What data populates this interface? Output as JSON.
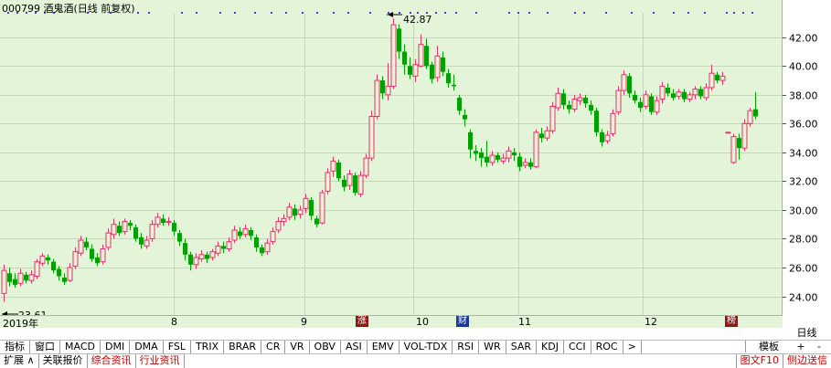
{
  "stock": {
    "code": "000799",
    "name": "酒鬼酒",
    "period": "(日线 前复权)"
  },
  "colors": {
    "up": "#e8306a",
    "down": "#00a000",
    "grid": "#c3d8b4",
    "background": "#e4f4d8"
  },
  "marks": {
    "high": "42.87",
    "low": "23.61"
  },
  "badges": {
    "rise": "涨",
    "fin": "财",
    "list": "榜"
  },
  "x_axis": {
    "year_label": "2019年",
    "months": [
      "8",
      "9",
      "10",
      "11",
      "12"
    ]
  },
  "right_panel": {
    "period_label": "日线",
    "template_label": "模板",
    "plus_label": "+",
    "minus_label": "-"
  },
  "tabs": [
    "指标",
    "窗口",
    "MACD",
    "DMI",
    "DMA",
    "FSL",
    "TRIX",
    "BRAR",
    "CR",
    "VR",
    "OBV",
    "ASI",
    "EMV",
    "VOL-TDX",
    "RSI",
    "WR",
    "SAR",
    "KDJ",
    "CCI",
    "ROC",
    ">"
  ],
  "status": {
    "expand": "扩展",
    "items": [
      "关联报价",
      "综合资讯",
      "行业资讯"
    ],
    "f10": "图文F10",
    "side": "侧边送信"
  },
  "chart_data": {
    "type": "candlestick",
    "y_axis_ticks": [
      24,
      26,
      28,
      30,
      32,
      34,
      36,
      38,
      40,
      42
    ],
    "y_tick_labels": [
      "24.00",
      "26.00",
      "28.00",
      "30.00",
      "32.00",
      "34.00",
      "36.00",
      "38.00",
      "40.00",
      "42.00"
    ],
    "ylim": [
      22.7,
      43.7
    ],
    "grid": true,
    "candles": [
      [
        24.2,
        25.8,
        26.2,
        23.61
      ],
      [
        25.6,
        25.0,
        26.0,
        24.7
      ],
      [
        25.2,
        24.8,
        25.6,
        24.6
      ],
      [
        24.9,
        25.6,
        25.9,
        24.7
      ],
      [
        25.5,
        25.1,
        25.7,
        24.9
      ],
      [
        25.1,
        25.5,
        25.8,
        24.9
      ],
      [
        25.4,
        26.4,
        26.6,
        25.2
      ],
      [
        26.3,
        26.8,
        27.0,
        26.1
      ],
      [
        26.7,
        26.5,
        26.9,
        26.2
      ],
      [
        26.4,
        25.8,
        26.6,
        25.6
      ],
      [
        25.9,
        25.4,
        26.1,
        25.1
      ],
      [
        25.3,
        25.0,
        25.6,
        24.8
      ],
      [
        25.1,
        26.0,
        26.3,
        25.0
      ],
      [
        26.1,
        27.1,
        27.4,
        25.9
      ],
      [
        27.0,
        27.9,
        28.2,
        26.8
      ],
      [
        27.8,
        27.4,
        28.1,
        27.2
      ],
      [
        27.3,
        26.6,
        27.6,
        26.4
      ],
      [
        26.7,
        26.3,
        27.0,
        26.1
      ],
      [
        26.4,
        27.3,
        27.6,
        26.2
      ],
      [
        27.4,
        28.4,
        28.7,
        27.2
      ],
      [
        28.3,
        29.0,
        29.4,
        28.0
      ],
      [
        28.9,
        28.4,
        29.2,
        28.2
      ],
      [
        28.5,
        29.2,
        29.4,
        28.3
      ],
      [
        29.1,
        28.9,
        29.3,
        28.6
      ],
      [
        28.8,
        28.0,
        29.0,
        27.8
      ],
      [
        28.1,
        27.6,
        28.4,
        27.3
      ],
      [
        27.5,
        27.9,
        28.2,
        27.3
      ],
      [
        28.0,
        29.0,
        29.3,
        27.8
      ],
      [
        29.0,
        29.5,
        29.8,
        28.8
      ],
      [
        29.4,
        29.1,
        29.7,
        28.9
      ],
      [
        29.2,
        29.2,
        29.5,
        28.9
      ],
      [
        29.1,
        28.5,
        29.3,
        28.2
      ],
      [
        28.4,
        27.8,
        28.6,
        27.5
      ],
      [
        27.7,
        26.9,
        28.0,
        26.5
      ],
      [
        26.9,
        26.2,
        27.1,
        25.8
      ],
      [
        26.2,
        26.7,
        27.0,
        25.9
      ],
      [
        26.6,
        26.9,
        27.2,
        26.4
      ],
      [
        26.9,
        26.6,
        27.1,
        26.3
      ],
      [
        26.7,
        27.1,
        27.3,
        26.5
      ],
      [
        27.0,
        27.5,
        27.8,
        26.8
      ],
      [
        27.5,
        27.3,
        27.8,
        27.0
      ],
      [
        27.3,
        27.8,
        28.1,
        27.1
      ],
      [
        27.9,
        28.6,
        28.9,
        27.7
      ],
      [
        28.5,
        28.2,
        28.8,
        28.0
      ],
      [
        28.3,
        28.7,
        29.0,
        28.1
      ],
      [
        28.6,
        28.2,
        28.8,
        27.9
      ],
      [
        28.1,
        27.4,
        28.3,
        27.1
      ],
      [
        27.4,
        27.0,
        27.6,
        26.8
      ],
      [
        27.1,
        27.7,
        28.0,
        26.9
      ],
      [
        27.8,
        28.5,
        28.8,
        27.6
      ],
      [
        28.6,
        29.2,
        29.5,
        28.4
      ],
      [
        29.2,
        29.4,
        29.7,
        28.9
      ],
      [
        29.5,
        30.2,
        30.5,
        29.3
      ],
      [
        30.1,
        29.6,
        30.4,
        29.3
      ],
      [
        29.7,
        30.0,
        30.3,
        29.4
      ],
      [
        30.1,
        30.8,
        31.1,
        29.8
      ],
      [
        30.7,
        29.6,
        30.9,
        29.3
      ],
      [
        29.4,
        29.0,
        29.6,
        28.8
      ],
      [
        29.1,
        31.2,
        31.4,
        29.0
      ],
      [
        31.3,
        32.6,
        32.9,
        31.1
      ],
      [
        32.7,
        33.4,
        33.7,
        32.3
      ],
      [
        33.3,
        32.2,
        33.5,
        32.0
      ],
      [
        32.1,
        31.6,
        32.4,
        31.3
      ],
      [
        31.7,
        32.5,
        32.8,
        31.4
      ],
      [
        32.4,
        31.2,
        32.6,
        31.0
      ],
      [
        31.1,
        32.4,
        32.7,
        30.9
      ],
      [
        32.4,
        33.6,
        33.9,
        32.2
      ],
      [
        33.6,
        36.5,
        36.9,
        33.4
      ],
      [
        36.5,
        39.0,
        39.4,
        36.3
      ],
      [
        39.0,
        38.1,
        39.3,
        37.7
      ],
      [
        38.0,
        38.6,
        40.2,
        37.6
      ],
      [
        38.6,
        42.87,
        43.3,
        38.4
      ],
      [
        42.6,
        41.0,
        42.9,
        40.5
      ],
      [
        41.0,
        40.1,
        41.5,
        39.4
      ],
      [
        40.0,
        39.4,
        40.6,
        39.1
      ],
      [
        39.3,
        40.1,
        40.5,
        38.9
      ],
      [
        40.0,
        41.5,
        42.2,
        39.9
      ],
      [
        41.4,
        40.0,
        41.9,
        39.8
      ],
      [
        40.1,
        39.1,
        40.3,
        38.8
      ],
      [
        39.2,
        40.7,
        41.4,
        38.9
      ],
      [
        40.6,
        39.6,
        41.0,
        39.3
      ],
      [
        39.5,
        38.8,
        39.8,
        38.5
      ],
      [
        38.7,
        38.6,
        39.4,
        38.3
      ],
      [
        37.8,
        36.9,
        38.0,
        36.6
      ],
      [
        36.6,
        36.3,
        37.0,
        35.8
      ],
      [
        35.4,
        34.2,
        35.6,
        33.6
      ],
      [
        34.1,
        33.9,
        34.5,
        33.4
      ],
      [
        34.0,
        33.6,
        34.3,
        33.0
      ],
      [
        33.7,
        33.3,
        34.8,
        33.0
      ],
      [
        33.3,
        33.8,
        34.1,
        33.1
      ],
      [
        33.8,
        33.5,
        34.0,
        33.3
      ],
      [
        33.4,
        33.6,
        33.9,
        33.2
      ],
      [
        33.6,
        34.1,
        34.4,
        33.3
      ],
      [
        34.0,
        33.8,
        34.3,
        33.4
      ],
      [
        33.7,
        33.0,
        34.0,
        32.7
      ],
      [
        33.1,
        33.3,
        33.6,
        32.9
      ],
      [
        33.3,
        33.0,
        33.6,
        32.8
      ],
      [
        33.0,
        35.4,
        35.6,
        32.9
      ],
      [
        35.3,
        35.0,
        35.7,
        34.7
      ],
      [
        35.0,
        35.5,
        35.8,
        34.8
      ],
      [
        35.5,
        37.2,
        37.5,
        35.3
      ],
      [
        37.1,
        38.1,
        38.5,
        36.9
      ],
      [
        38.1,
        37.3,
        38.4,
        37.0
      ],
      [
        37.3,
        37.0,
        37.6,
        36.7
      ],
      [
        37.0,
        37.7,
        38.0,
        36.8
      ],
      [
        37.6,
        37.8,
        38.1,
        37.3
      ],
      [
        37.8,
        37.4,
        38.0,
        37.1
      ],
      [
        37.3,
        36.9,
        37.6,
        36.6
      ],
      [
        36.9,
        35.4,
        37.1,
        35.1
      ],
      [
        35.4,
        34.7,
        35.6,
        34.4
      ],
      [
        34.8,
        35.2,
        35.5,
        34.6
      ],
      [
        35.3,
        36.7,
        37.0,
        35.1
      ],
      [
        36.8,
        38.3,
        38.6,
        36.6
      ],
      [
        38.3,
        39.4,
        39.7,
        38.0
      ],
      [
        39.3,
        38.1,
        39.5,
        37.8
      ],
      [
        38.0,
        37.6,
        38.3,
        37.4
      ],
      [
        37.5,
        37.1,
        37.8,
        36.8
      ],
      [
        37.2,
        38.0,
        38.3,
        37.0
      ],
      [
        37.9,
        36.8,
        38.1,
        36.6
      ],
      [
        36.8,
        37.6,
        37.9,
        36.6
      ],
      [
        37.7,
        38.6,
        38.9,
        37.4
      ],
      [
        38.5,
        38.1,
        38.8,
        37.9
      ],
      [
        38.1,
        37.8,
        38.4,
        37.6
      ],
      [
        37.9,
        38.2,
        38.4,
        37.7
      ],
      [
        38.2,
        37.7,
        38.4,
        37.5
      ],
      [
        37.7,
        38.0,
        38.2,
        37.5
      ],
      [
        38.0,
        38.4,
        38.6,
        37.7
      ],
      [
        38.4,
        37.9,
        38.6,
        37.7
      ],
      [
        37.8,
        38.5,
        38.8,
        37.6
      ],
      [
        38.5,
        39.5,
        40.1,
        38.3
      ],
      [
        39.4,
        39.0,
        39.6,
        38.8
      ],
      [
        39.0,
        39.3,
        39.6,
        38.7
      ],
      [
        35.4,
        35.4,
        35.4,
        35.4
      ],
      [
        33.3,
        35.1,
        35.3,
        33.2
      ],
      [
        35.0,
        34.3,
        35.3,
        33.5
      ],
      [
        34.3,
        36.0,
        36.3,
        34.1
      ],
      [
        36.0,
        36.9,
        37.1,
        35.8
      ],
      [
        37.0,
        36.5,
        38.2,
        36.3
      ]
    ]
  }
}
